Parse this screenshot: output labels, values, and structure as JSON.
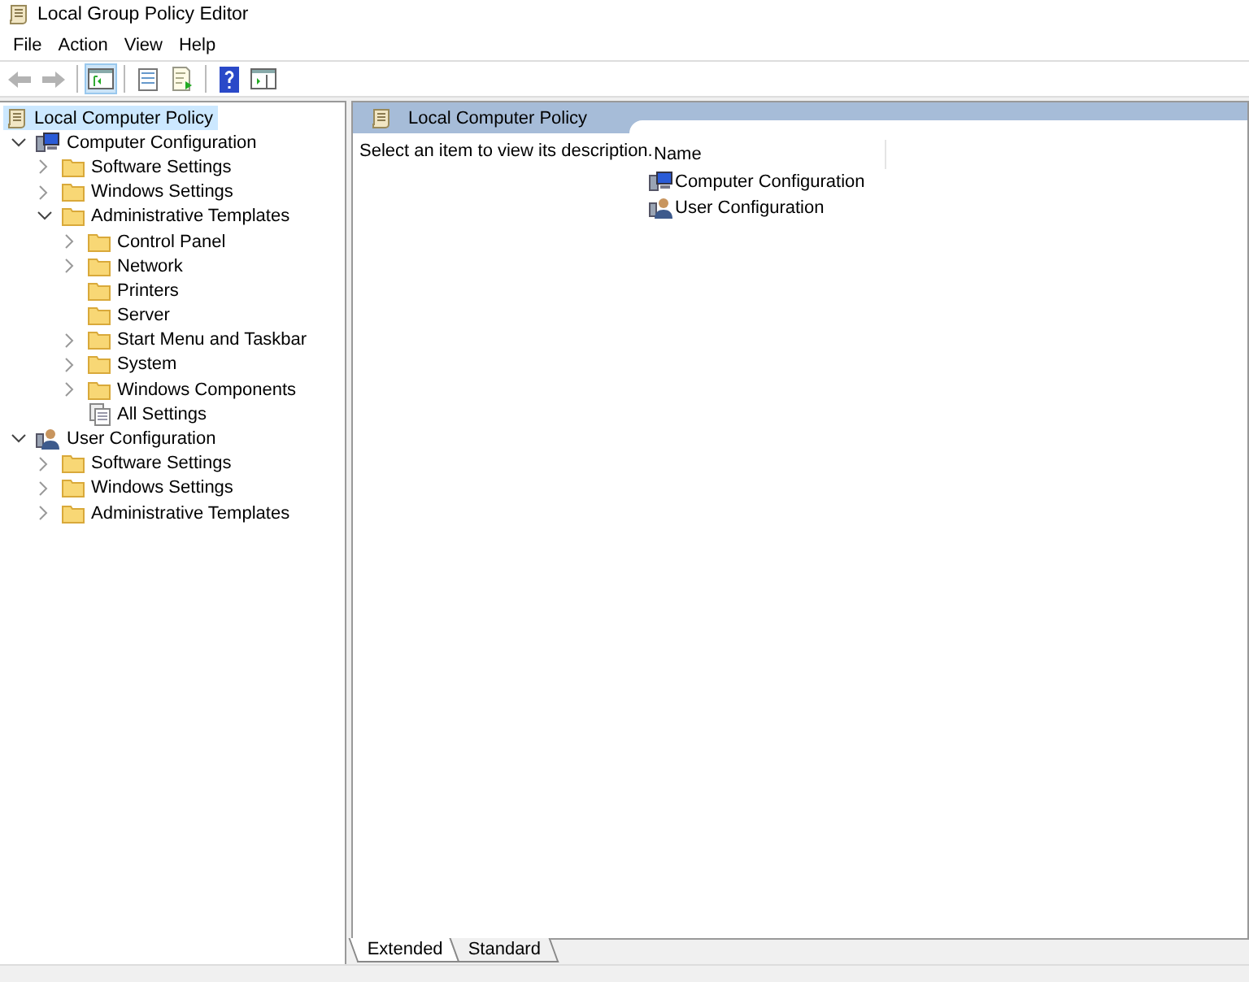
{
  "window": {
    "title": "Local Group Policy Editor"
  },
  "menu": [
    "File",
    "Action",
    "View",
    "Help"
  ],
  "toolbar": [
    {
      "kind": "back",
      "disabled": true,
      "pressed": false
    },
    {
      "kind": "forward",
      "disabled": true,
      "pressed": false
    },
    {
      "kind": "separator"
    },
    {
      "kind": "tree-toggle",
      "disabled": false,
      "pressed": true
    },
    {
      "kind": "separator"
    },
    {
      "kind": "properties",
      "disabled": false,
      "pressed": false
    },
    {
      "kind": "export",
      "disabled": false,
      "pressed": false
    },
    {
      "kind": "separator"
    },
    {
      "kind": "help",
      "disabled": false,
      "pressed": false
    },
    {
      "kind": "view",
      "disabled": false,
      "pressed": false
    }
  ],
  "tree": [
    {
      "label": "Local Computer Policy",
      "kind": "policy",
      "selected": true,
      "children": [
        {
          "label": "Computer Configuration",
          "kind": "computer",
          "selected": false,
          "has_children": true,
          "expanded": true,
          "children": [
            {
              "label": "Software Settings",
              "kind": "folder",
              "selected": false,
              "has_children": true,
              "expanded": false
            },
            {
              "label": "Windows Settings",
              "kind": "folder",
              "selected": false,
              "has_children": true,
              "expanded": false
            },
            {
              "label": "Administrative Templates",
              "kind": "folder",
              "selected": false,
              "has_children": true,
              "expanded": true,
              "children": [
                {
                  "label": "Control Panel",
                  "kind": "folder",
                  "selected": false,
                  "has_children": true,
                  "expanded": false
                },
                {
                  "label": "Network",
                  "kind": "folder",
                  "selected": false,
                  "has_children": true,
                  "expanded": false
                },
                {
                  "label": "Printers",
                  "kind": "folder",
                  "selected": false,
                  "has_children": false
                },
                {
                  "label": "Server",
                  "kind": "folder",
                  "selected": false,
                  "has_children": false
                },
                {
                  "label": "Start Menu and Taskbar",
                  "kind": "folder",
                  "selected": false,
                  "has_children": true,
                  "expanded": false
                },
                {
                  "label": "System",
                  "kind": "folder",
                  "selected": false,
                  "has_children": true,
                  "expanded": false
                },
                {
                  "label": "Windows Components",
                  "kind": "folder",
                  "selected": false,
                  "has_children": true,
                  "expanded": false
                },
                {
                  "label": "All Settings",
                  "kind": "settings",
                  "selected": false,
                  "has_children": false
                }
              ]
            }
          ]
        },
        {
          "label": "User Configuration",
          "kind": "user",
          "selected": false,
          "has_children": true,
          "expanded": true,
          "children": [
            {
              "label": "Software Settings",
              "kind": "folder",
              "selected": false,
              "has_children": true,
              "expanded": false
            },
            {
              "label": "Windows Settings",
              "kind": "folder",
              "selected": false,
              "has_children": true,
              "expanded": false
            },
            {
              "label": "Administrative Templates",
              "kind": "folder",
              "selected": false,
              "has_children": true,
              "expanded": false
            }
          ]
        }
      ]
    }
  ],
  "details": {
    "title": "Local Computer Policy",
    "description": "Select an item to view its description.",
    "column": "Name",
    "items": [
      {
        "label": "Computer Configuration",
        "kind": "computer"
      },
      {
        "label": "User Configuration",
        "kind": "user"
      }
    ]
  },
  "tabs": [
    {
      "label": "Extended",
      "selected": true
    },
    {
      "label": "Standard",
      "selected": false
    }
  ]
}
